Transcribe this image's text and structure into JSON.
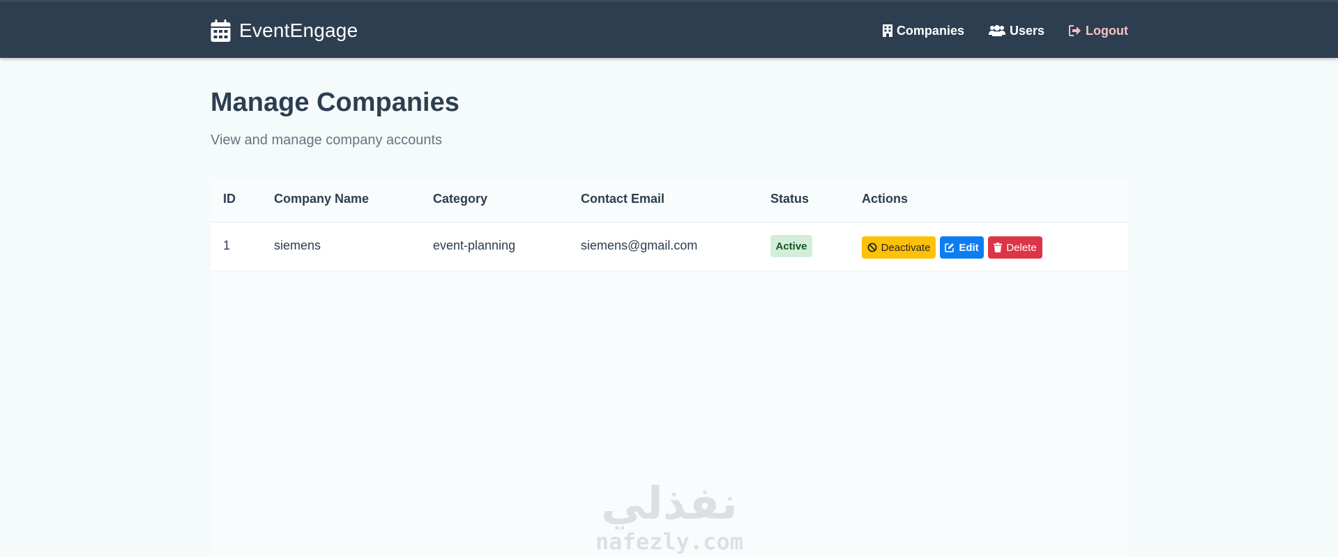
{
  "nav": {
    "brand": "EventEngage",
    "brand_icon": "calendar-icon",
    "links": [
      {
        "label": "Companies",
        "icon": "building-icon"
      },
      {
        "label": "Users",
        "icon": "users-icon"
      },
      {
        "label": "Logout",
        "icon": "sign-out-icon"
      }
    ]
  },
  "page": {
    "title": "Manage Companies",
    "subtitle": "View and manage company accounts"
  },
  "table": {
    "headers": [
      "ID",
      "Company Name",
      "Category",
      "Contact Email",
      "Status",
      "Actions"
    ],
    "rows": [
      {
        "id": "1",
        "name": "siemens",
        "category": "event-planning",
        "email": "siemens@gmail.com",
        "status": "Active",
        "actions": {
          "deactivate": "Deactivate",
          "edit": "Edit",
          "delete": "Delete"
        }
      }
    ]
  },
  "watermark": {
    "arabic": "نفذلي",
    "latin": "nafezly.com"
  },
  "colors": {
    "navbar": "#2d3e50",
    "logout": "#f6c0c4",
    "active_badge_bg": "#d4edda",
    "active_badge_text": "#155724",
    "deactivate": "#ffc107",
    "edit": "#0d7ef0",
    "delete": "#dc3545"
  }
}
